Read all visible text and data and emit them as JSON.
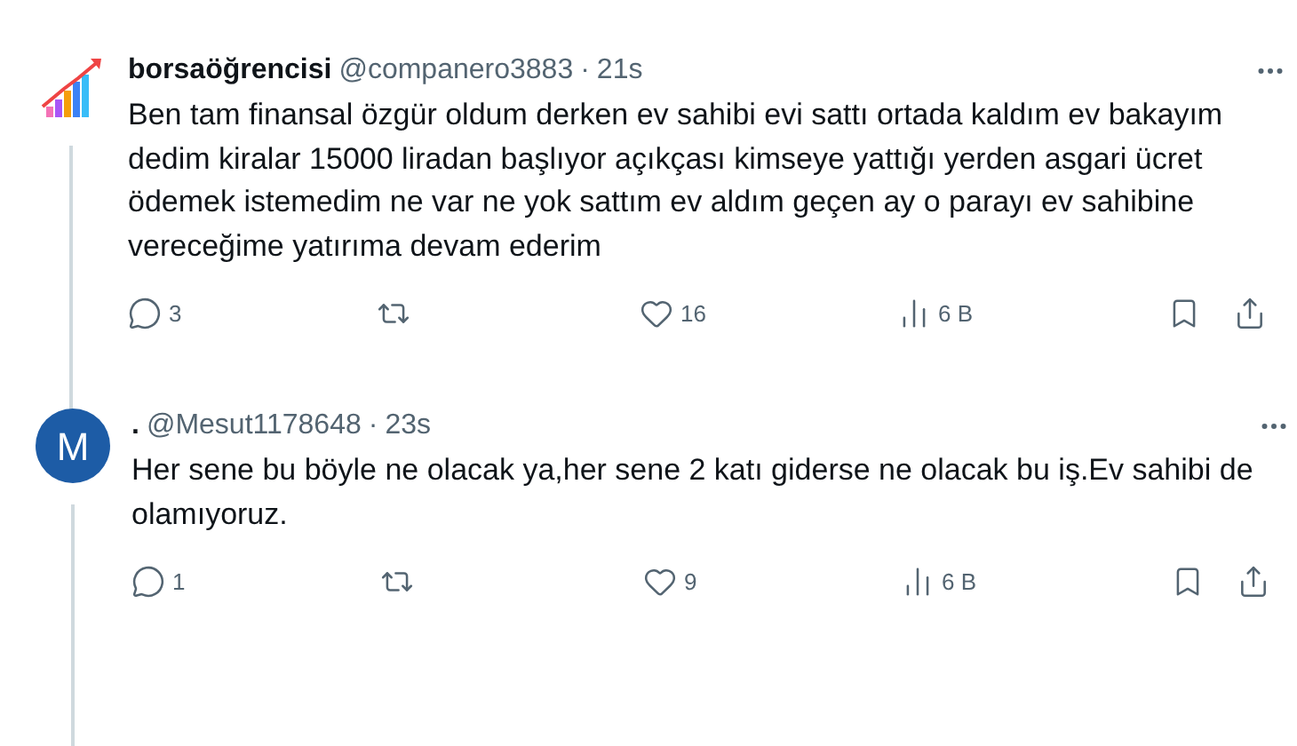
{
  "tweets": [
    {
      "avatar": {
        "kind": "logo"
      },
      "display_name": "borsaöğrencisi",
      "handle": "@companero3883",
      "separator": "·",
      "time": "21s",
      "text": "Ben tam finansal özgür oldum derken ev sahibi evi sattı ortada kaldım ev bakayım dedim kiralar 15000 liradan başlıyor açıkçası kimseye yattığı yerden asgari ücret ödemek istemedim ne var ne yok sattım ev aldım geçen ay o parayı ev sahibine vereceğime yatırıma devam ederim",
      "thread_line": true,
      "replies": "3",
      "likes": "16",
      "views": "6 B"
    },
    {
      "avatar": {
        "kind": "letter",
        "letter": "M",
        "color": "#1d5ca6"
      },
      "display_name": ".",
      "handle": "@Mesut1178648",
      "separator": "·",
      "time": "23s",
      "text": "Her sene bu böyle ne olacak ya,her sene 2 katı giderse ne olacak bu iş.Ev sahibi de olamıyoruz.",
      "thread_line": true,
      "replies": "1",
      "likes": "9",
      "views": "6 B"
    }
  ]
}
